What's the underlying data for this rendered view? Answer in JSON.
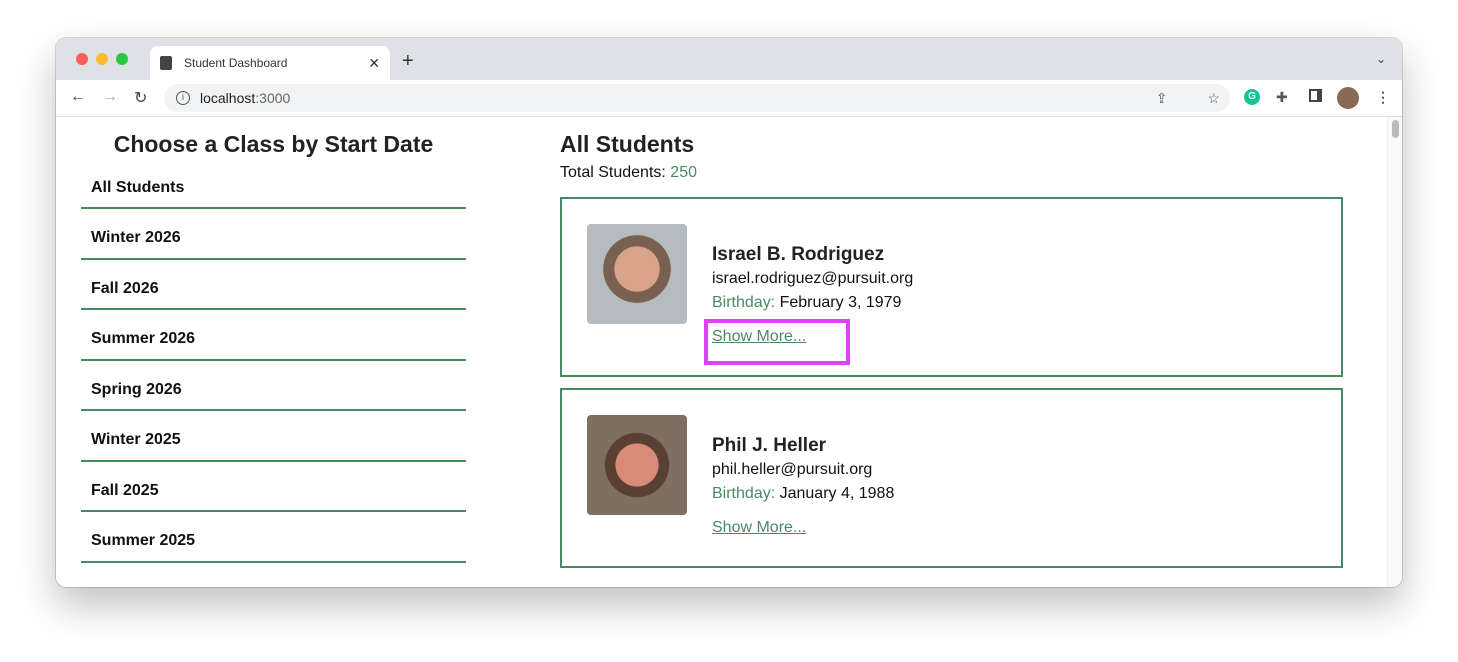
{
  "browser": {
    "tab_title": "Student Dashboard",
    "url_host": "localhost",
    "url_port": ":3000"
  },
  "sidebar": {
    "title": "Choose a Class by Start Date",
    "items": [
      "All Students",
      "Winter 2026",
      "Fall 2026",
      "Summer 2026",
      "Spring 2026",
      "Winter 2025",
      "Fall 2025",
      "Summer 2025"
    ]
  },
  "main": {
    "title": "All Students",
    "total_label": "Total Students: ",
    "total_value": "250",
    "students": [
      {
        "name": "Israel B. Rodriguez",
        "email": "israel.rodriguez@pursuit.org",
        "birthday_label": "Birthday: ",
        "birthday": "February 3, 1979",
        "more": "Show More..."
      },
      {
        "name": "Phil J. Heller",
        "email": "phil.heller@pursuit.org",
        "birthday_label": "Birthday: ",
        "birthday": "January 4, 1988",
        "more": "Show More..."
      }
    ]
  },
  "colors": {
    "accent": "#4a8a63",
    "highlight": "#e040fb"
  }
}
